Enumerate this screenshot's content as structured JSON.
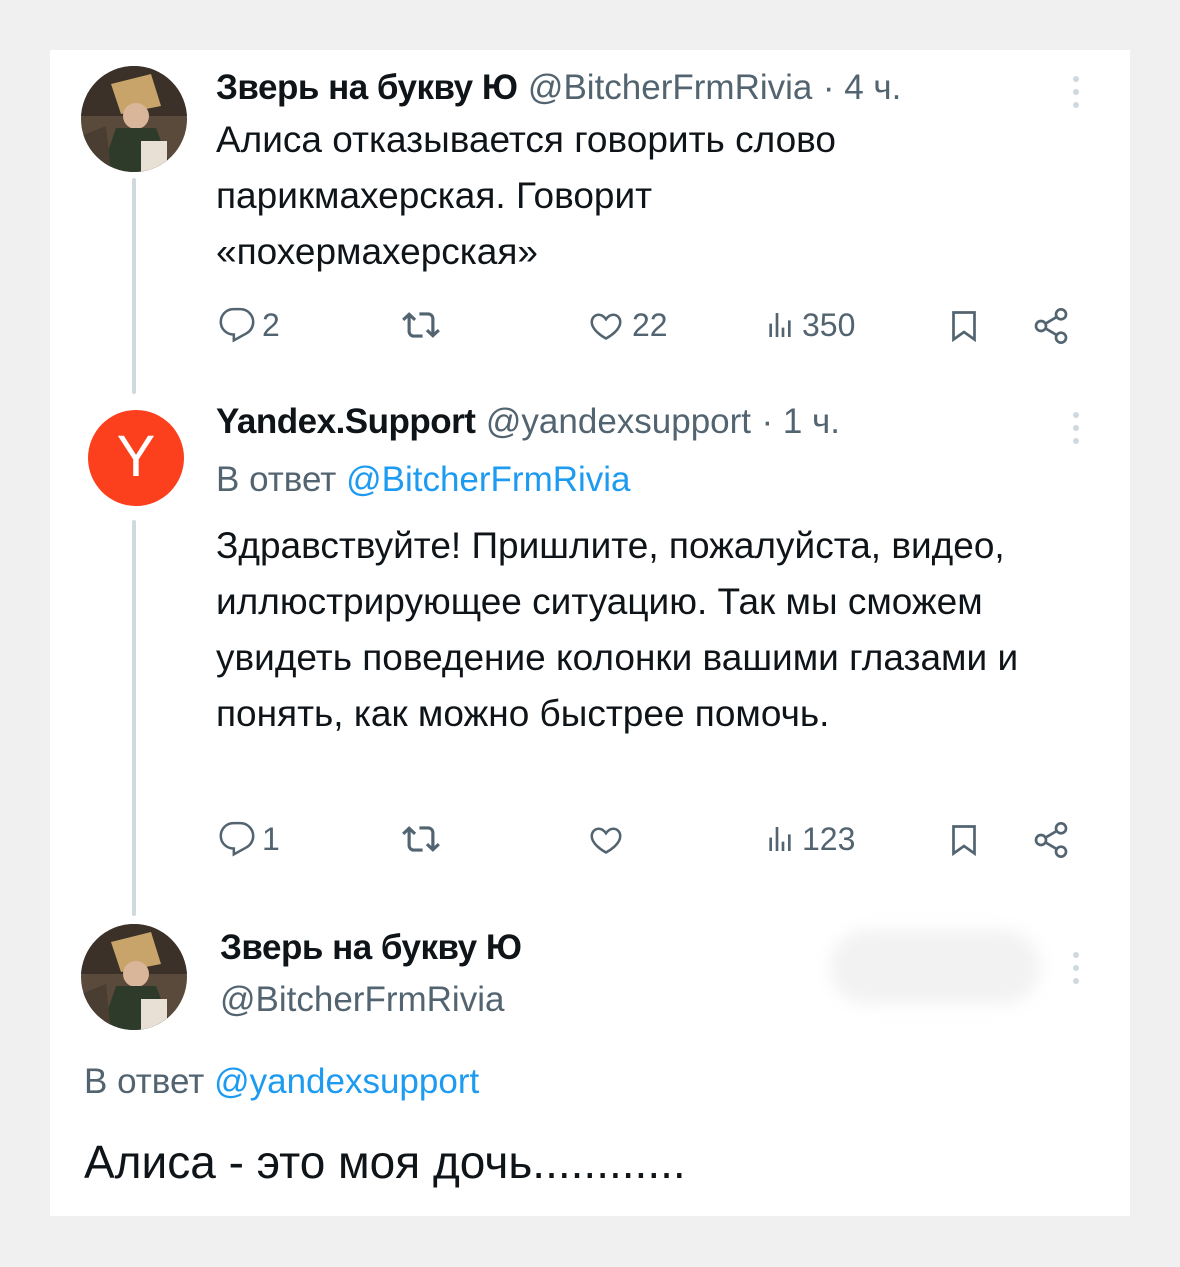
{
  "tweets": [
    {
      "name": "Зверь на букву Ю",
      "handle": "@BitcherFrmRivia",
      "time": "· 4 ч.",
      "text": "Алиса отказывается говорить слово парикмахерская. Говорит «похермахерская»",
      "actions": {
        "replies": "2",
        "retweets": "",
        "likes": "22",
        "views": "350"
      }
    },
    {
      "name": "Yandex.Support",
      "handle": "@yandexsupport",
      "time": "· 1 ч.",
      "reply_prefix": "В ответ",
      "reply_mention": "@BitcherFrmRivia",
      "text": "Здравствуйте! Пришлите, пожалуйста, видео, иллюстрирующее ситуацию. Так мы сможем увидеть поведение колонки вашими глазами и понять, как можно быстрее помочь.",
      "actions": {
        "replies": "1",
        "retweets": "",
        "likes": "",
        "views": "123"
      }
    }
  ],
  "main": {
    "name": "Зверь на букву Ю",
    "handle": "@BitcherFrmRivia",
    "reply_prefix": "В ответ",
    "reply_mention": "@yandexsupport",
    "text": "Алиса - это моя дочь............"
  },
  "avatar_letter": "Y",
  "colors": {
    "accent": "#1d9bf0",
    "yandex": "#fc3f1d",
    "muted": "#536471"
  },
  "icons": [
    "reply-icon",
    "retweet-icon",
    "like-icon",
    "views-icon",
    "bookmark-icon",
    "share-icon",
    "more-icon"
  ]
}
